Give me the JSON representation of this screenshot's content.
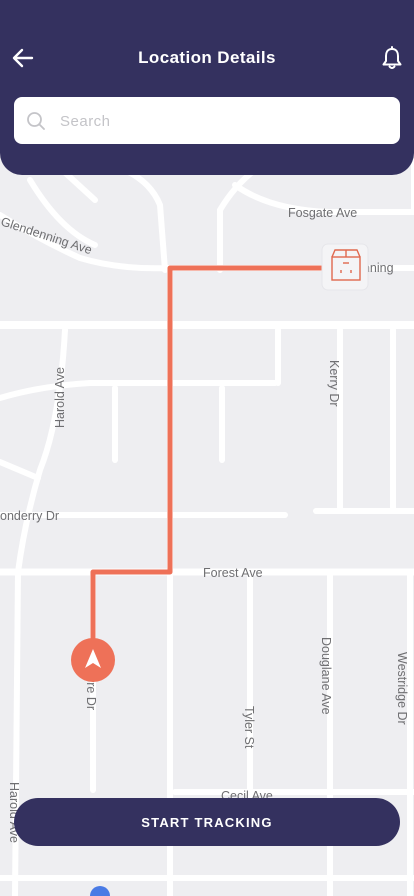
{
  "header": {
    "title": "Location Details",
    "back_icon": "arrow-left-icon",
    "notification_icon": "bell-icon"
  },
  "search": {
    "placeholder": "Search",
    "icon": "search-icon"
  },
  "map": {
    "streets": [
      "Fosgate Ave",
      "Glendenning Ave",
      "enning",
      "Harold Ave",
      "Kerry Dr",
      "onderry Dr",
      "Forest Ave",
      "Douglane Ave",
      "Westridge Dr",
      "Tyler St",
      "yre Dr",
      "Cecil Ave",
      "Harold Ave"
    ],
    "route_color": "#ee7158",
    "destination_icon": "package-box-icon",
    "origin_icon": "navigation-arrow-icon"
  },
  "actions": {
    "start_label": "START TRACKING"
  },
  "colors": {
    "primary": "#34315f",
    "accent": "#ee7158"
  }
}
